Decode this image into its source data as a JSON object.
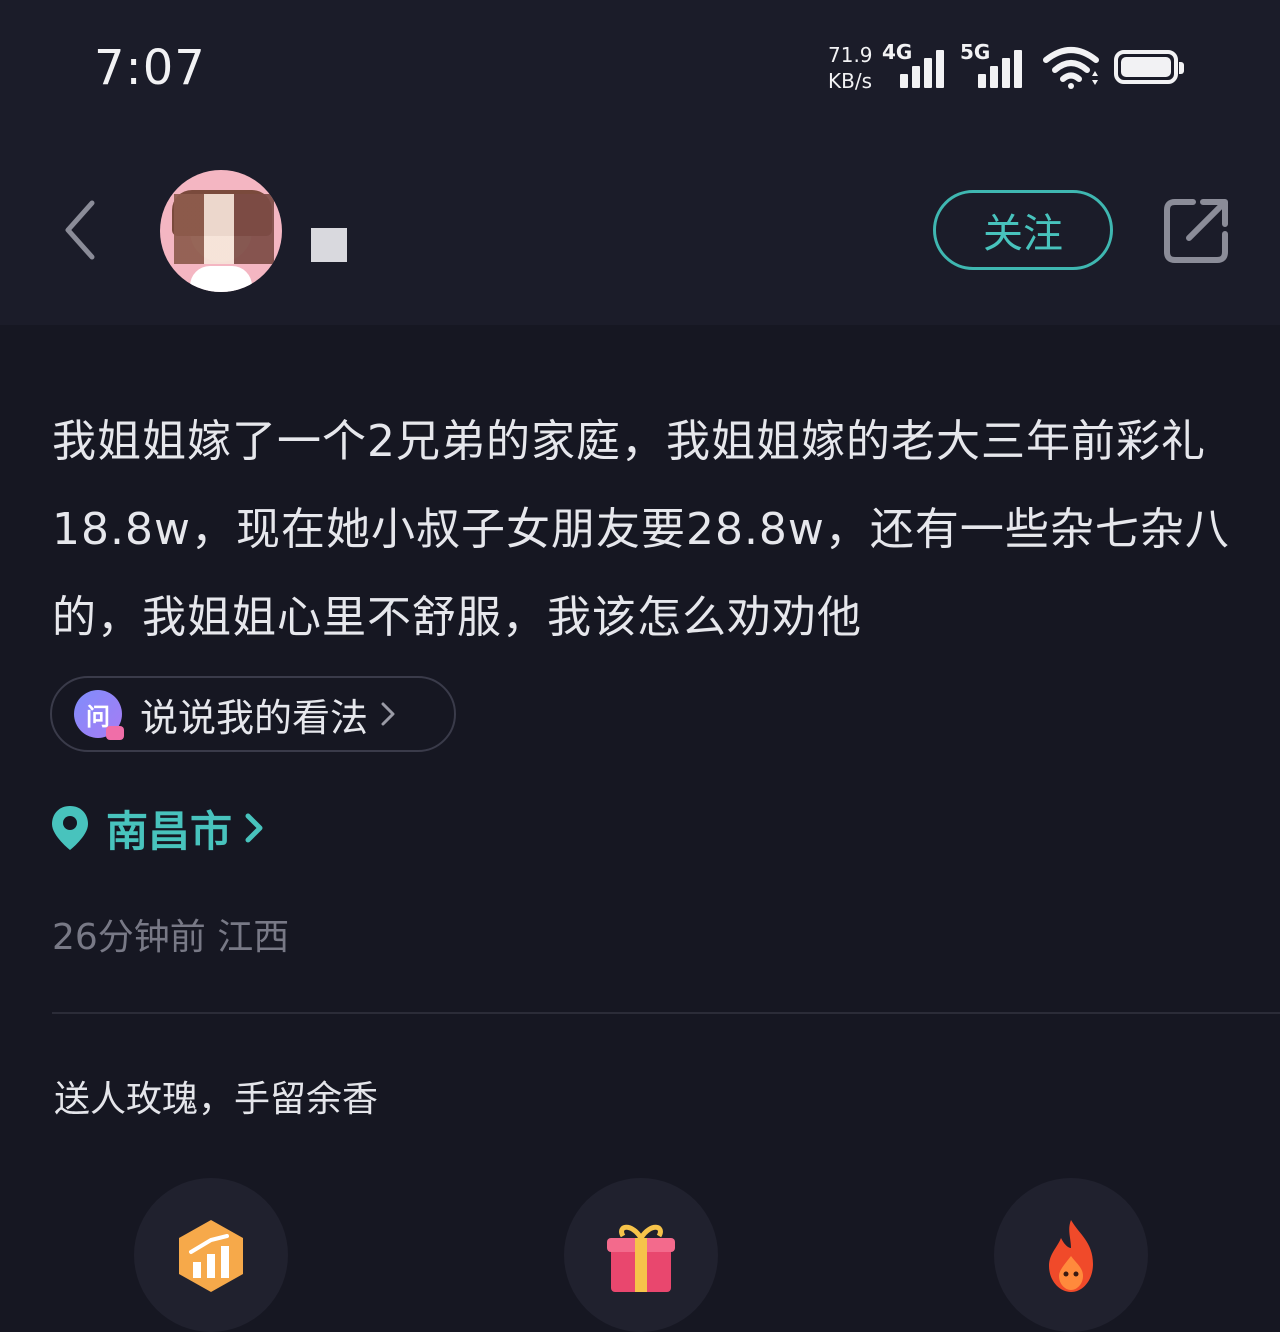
{
  "status_bar": {
    "time": "7:07",
    "net_speed_value": "71.9",
    "net_speed_unit": "KB/s",
    "signal_1_label": "4G",
    "signal_2_label": "5G",
    "icons": [
      "signal-4g-icon",
      "signal-5g-icon",
      "wifi-icon",
      "battery-icon"
    ]
  },
  "header": {
    "follow_label": "关注",
    "icons": [
      "back-chevron-icon",
      "share-icon"
    ]
  },
  "post": {
    "body": "我姐姐嫁了一个2兄弟的家庭，我姐姐嫁的老大三年前彩礼18.8w，现在她小叔子女朋友要28.8w，还有一些杂七杂八的，我姐姐心里不舒服，我该怎么劝劝他",
    "opinion_icon_text": "问",
    "opinion_label": "说说我的看法",
    "location": "南昌市",
    "meta": "26分钟前 江西"
  },
  "gifts": {
    "caption": "送人玫瑰，手留余香",
    "icons": [
      "boost-icon",
      "gift-box-icon",
      "fire-icon"
    ]
  },
  "colors": {
    "background": "#161722",
    "header_background": "#1b1c29",
    "accent": "#48c3bd",
    "muted_text": "#787986"
  }
}
